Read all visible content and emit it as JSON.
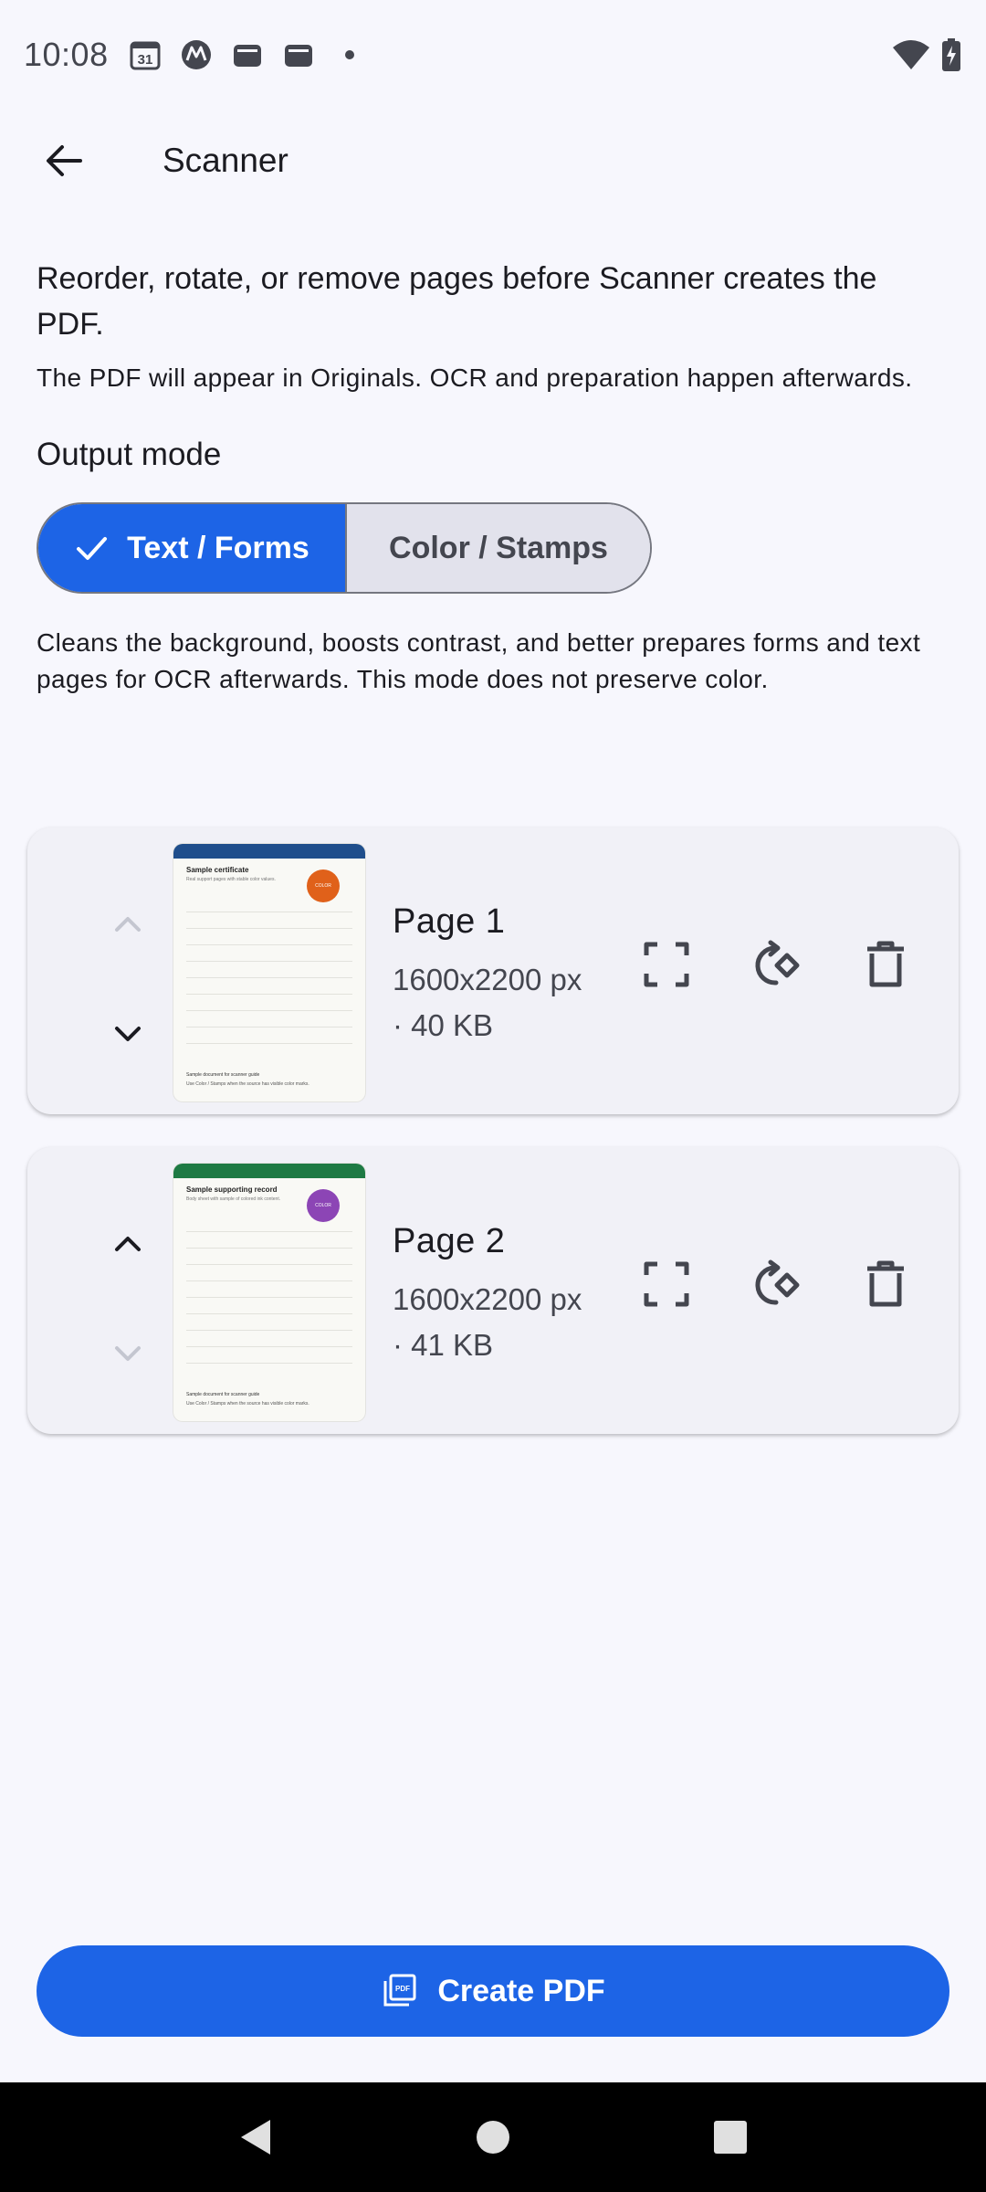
{
  "status_bar": {
    "time": "10:08",
    "calendar_day": "31",
    "icons": [
      "calendar-icon",
      "motorola-icon",
      "wallet-icon",
      "wallet-icon",
      "dot-icon",
      "wifi-icon",
      "battery-charging-icon"
    ]
  },
  "app_bar": {
    "title": "Scanner",
    "back_icon": "arrow-back-icon"
  },
  "intro": {
    "headline": "Reorder, rotate, or remove pages before Scanner creates the PDF.",
    "subtext": "The PDF will appear in Originals. OCR and preparation happen afterwards."
  },
  "output_mode": {
    "label": "Output mode",
    "options": [
      {
        "label": "Text / Forms",
        "selected": true
      },
      {
        "label": "Color / Stamps",
        "selected": false
      }
    ],
    "description": "Cleans the background, boosts contrast, and better prepares forms and text pages for OCR afterwards. This mode does not preserve color."
  },
  "pages": [
    {
      "title": "Page 1",
      "dimensions": "1600x2200 px",
      "size": "· 40 KB",
      "move_up_enabled": false,
      "move_down_enabled": true,
      "thumbnail": {
        "header_color": "#1f4e8c",
        "doc_title": "Sample certificate",
        "doc_sub": "Real support pages with stable color values.",
        "badge_color": "#e0611a",
        "badge_text": "COLOR",
        "footer_1": "Sample document for scanner guide",
        "footer_2": "Use Color / Stamps when the source has visible color marks."
      }
    },
    {
      "title": "Page 2",
      "dimensions": "1600x2200 px",
      "size": "· 41 KB",
      "move_up_enabled": true,
      "move_down_enabled": false,
      "thumbnail": {
        "header_color": "#1e7a44",
        "doc_title": "Sample supporting record",
        "doc_sub": "Body sheet with sample of colored ink content.",
        "badge_color": "#8c45b5",
        "badge_text": "COLOR",
        "footer_1": "Sample document for scanner guide",
        "footer_2": "Use Color / Stamps when the source has visible color marks."
      }
    }
  ],
  "page_actions": [
    "crop-icon",
    "rotate-icon",
    "delete-icon"
  ],
  "create_button": {
    "label": "Create PDF",
    "icon": "pdf-icon"
  },
  "colors": {
    "primary": "#1d64e6",
    "background": "#f7f7fd",
    "card": "#f1f1f7"
  }
}
